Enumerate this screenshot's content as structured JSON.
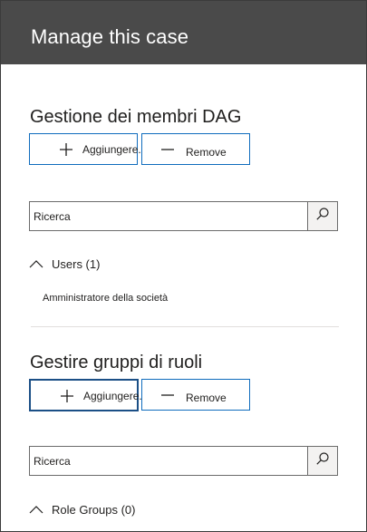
{
  "header": {
    "title": "Manage this case"
  },
  "members_section": {
    "title": "Gestione dei membri DAG",
    "add_label": "Aggiungere...",
    "remove_label": "Remove",
    "search_value": "Ricerca",
    "group_label": "Users (1)",
    "items": [
      "Amministratore della società"
    ]
  },
  "roles_section": {
    "title": "Gestire gruppi di ruoli",
    "add_label": "Aggiungere...",
    "remove_label": "Remove",
    "search_value": "Ricerca",
    "group_label": "Role Groups (0)"
  },
  "icons": {
    "add": "plus-icon",
    "remove": "minus-icon",
    "search": "search-icon",
    "group_toggle": "chevron-up-icon"
  },
  "colors": {
    "header_bg": "#4a4a4a",
    "accent_border": "#0f6cbd",
    "focus_border": "#1b4f86"
  }
}
